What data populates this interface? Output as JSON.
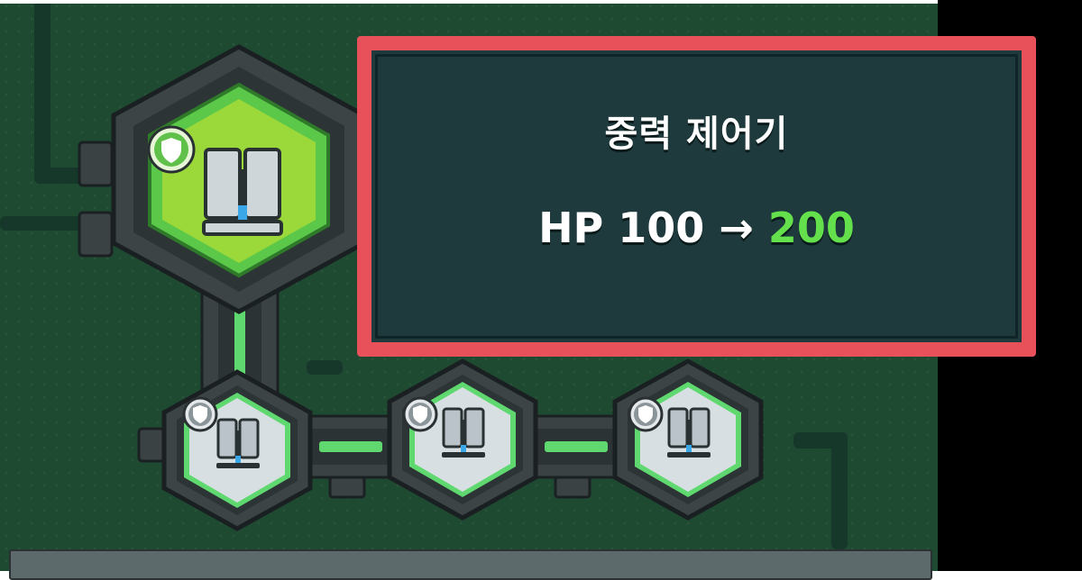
{
  "tooltip": {
    "title": "중력 제어기",
    "stat_label": "HP",
    "old_value": "100",
    "arrow": "→",
    "new_value": "200"
  },
  "skill_tree": {
    "nodes": [
      {
        "name": "gravity-controller",
        "state": "selected",
        "icon": "machine-icon",
        "badge": "shield-icon"
      },
      {
        "name": "node-2",
        "state": "unlocked",
        "icon": "machine-icon",
        "badge": "shield-icon"
      },
      {
        "name": "node-3",
        "state": "unlocked",
        "icon": "machine-icon",
        "badge": "shield-icon"
      },
      {
        "name": "node-4",
        "state": "unlocked",
        "icon": "machine-icon",
        "badge": "shield-icon"
      }
    ]
  },
  "colors": {
    "background": "#1f4a32",
    "selected_fill": "#9bd83a",
    "connector": "#5fd870",
    "tooltip_border": "#e8505a",
    "tooltip_bg": "#1e3a3c",
    "new_value": "#63e04c"
  }
}
